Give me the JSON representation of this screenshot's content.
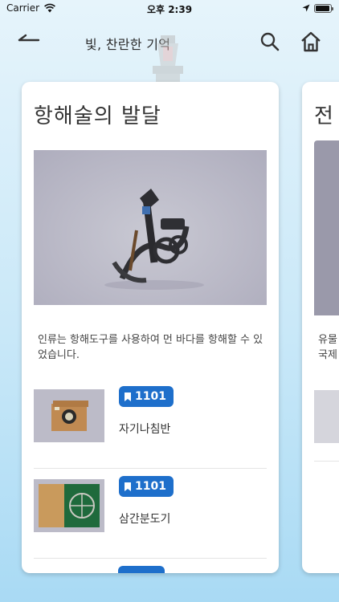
{
  "status_bar": {
    "carrier": "Carrier",
    "time": "오후 2:39",
    "battery_level": 0.92
  },
  "nav": {
    "title": "빛, 찬란한 기억",
    "back_icon": "back-arrow-icon",
    "search_icon": "search-icon",
    "home_icon": "home-icon"
  },
  "card_main": {
    "title": "항해술의 발달",
    "description": "인류는 항해도구를 사용하여 먼 바다를 항해할 수 있었습니다.",
    "items": [
      {
        "badge": "1101",
        "name": "자기나침반"
      },
      {
        "badge": "1101",
        "name": "삼간분도기"
      }
    ]
  },
  "card_next": {
    "title": "전",
    "description_line1": "유물",
    "description_line2": "국제"
  },
  "colors": {
    "accent": "#1e6fcb",
    "background_top": "#e6f4fb",
    "background_bottom": "#a9daf4"
  }
}
